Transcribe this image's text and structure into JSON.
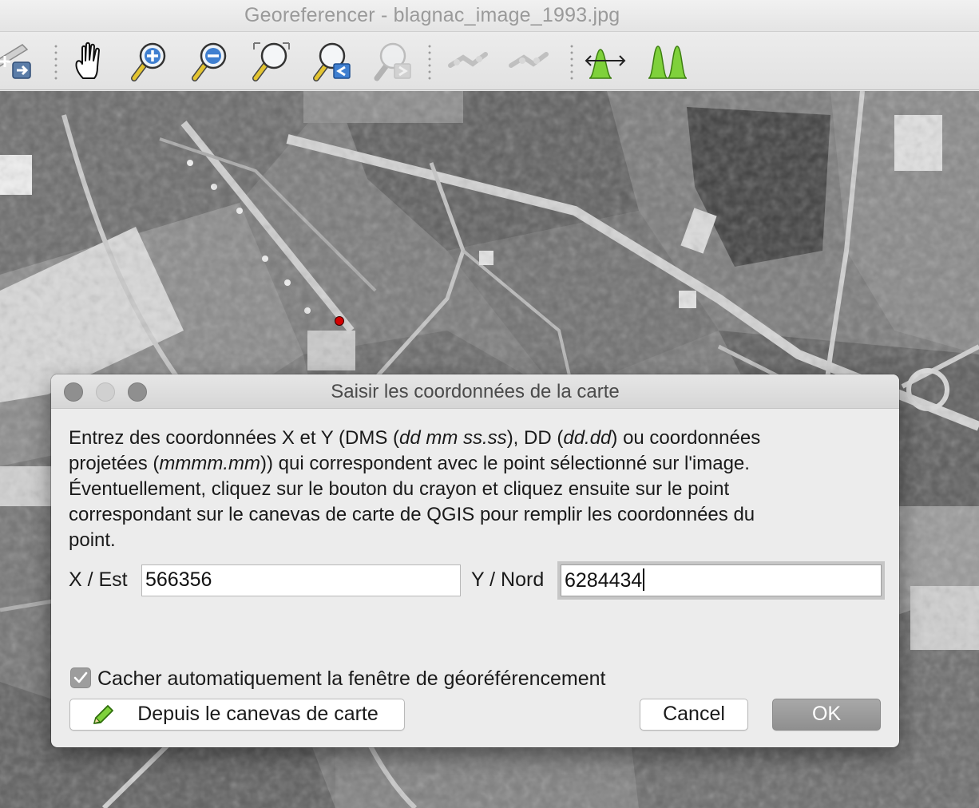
{
  "window": {
    "title": "Georeferencer - blagnac_image_1993.jpg"
  },
  "toolbar": {
    "tools": [
      {
        "name": "add-point",
        "icon": "add-point-icon"
      },
      {
        "name": "pan",
        "icon": "hand-icon"
      },
      {
        "name": "zoom-in",
        "icon": "zoom-in-icon"
      },
      {
        "name": "zoom-out",
        "icon": "zoom-out-icon"
      },
      {
        "name": "zoom-to-layer",
        "icon": "zoom-full-icon"
      },
      {
        "name": "zoom-last",
        "icon": "zoom-last-icon"
      },
      {
        "name": "zoom-next",
        "icon": "zoom-next-icon"
      },
      {
        "name": "link-georef",
        "icon": "link-georef-icon"
      },
      {
        "name": "link-qgis",
        "icon": "link-qgis-icon"
      },
      {
        "name": "full-histogram-stretch",
        "icon": "stretch-icon"
      },
      {
        "name": "local-histogram-stretch",
        "icon": "histogram-icon"
      }
    ]
  },
  "dialog": {
    "title": "Saisir les coordonnées de la carte",
    "description_lines": [
      "Entrez des coordonnées X et Y (DMS (",
      "dd mm ss.ss",
      "), DD (",
      "dd.dd",
      ") ou coordonnées",
      "projetées (",
      "mmmm.mm",
      ")) qui correspondent avec le point sélectionné sur l'image.",
      "Éventuellement, cliquez sur le bouton du crayon et cliquez ensuite sur le point",
      "correspondant sur le canevas de carte de QGIS pour remplir les coordonnées du",
      "point."
    ],
    "x_label": "X / Est",
    "x_value": "566356",
    "y_label": "Y / Nord",
    "y_value": "6284434",
    "checkbox_label": "Cacher automatiquement la fenêtre de géoréférencement",
    "checkbox_checked": true,
    "from_canvas_label": "Depuis le canevas de carte",
    "cancel_label": "Cancel",
    "ok_label": "OK"
  },
  "colors": {
    "gcp_point": "#d40000",
    "accent_green": "#7fd13b"
  }
}
